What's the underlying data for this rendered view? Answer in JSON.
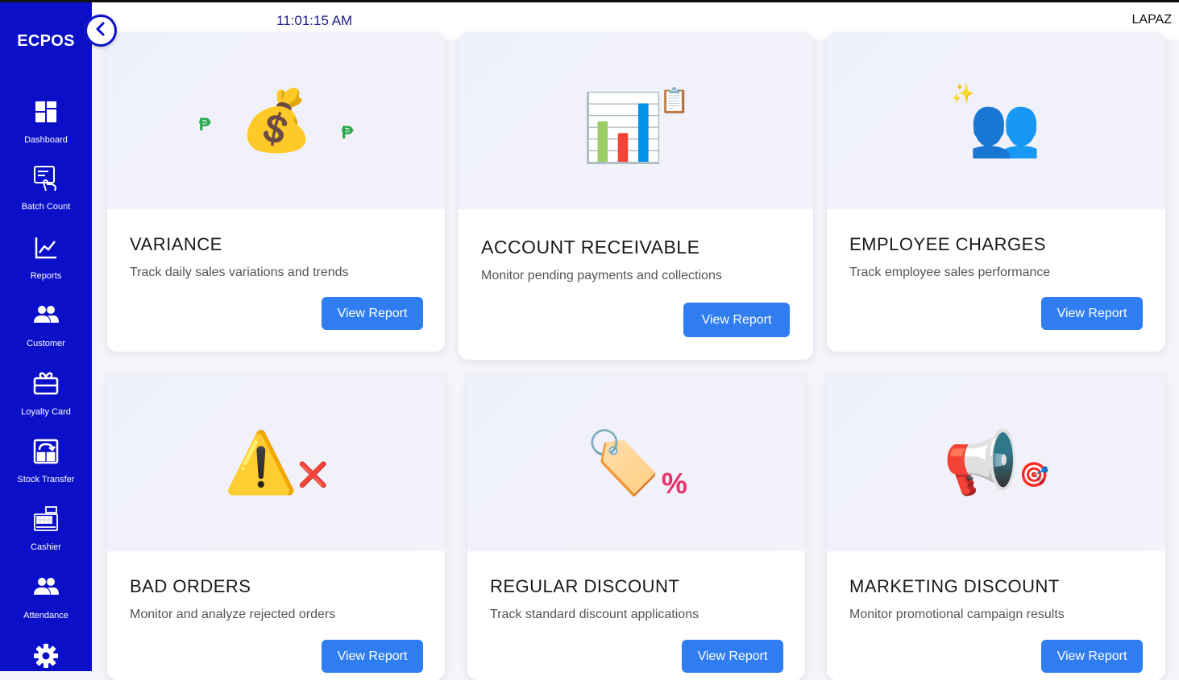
{
  "app": {
    "brand": "ECPOS"
  },
  "header": {
    "time": "11:01:15 AM",
    "branch": "LAPAZ"
  },
  "sidebar": {
    "items": [
      {
        "label": "Dashboard",
        "icon": "dashboard-icon"
      },
      {
        "label": "Batch Count",
        "icon": "batch-count-icon"
      },
      {
        "label": "Reports",
        "icon": "chart-line-icon"
      },
      {
        "label": "Customer",
        "icon": "people-icon"
      },
      {
        "label": "Loyalty Card",
        "icon": "gift-card-icon"
      },
      {
        "label": "Stock Transfer",
        "icon": "stock-transfer-icon"
      },
      {
        "label": "Cashier",
        "icon": "cash-register-icon"
      },
      {
        "label": "Attendance",
        "icon": "people-icon"
      },
      {
        "label": "",
        "icon": "gear-icon"
      }
    ]
  },
  "cards": [
    {
      "title": "VARIANCE",
      "description": "Track daily sales variations and trends",
      "button": "View Report",
      "icon": "money-bag-icon",
      "icon_glyph": "💰",
      "accent": "₱"
    },
    {
      "title": "ACCOUNT RECEIVABLE",
      "description": "Monitor pending payments and collections",
      "button": "View Report",
      "icon": "bar-chart-icon",
      "icon_glyph": "📊",
      "accent": "📋"
    },
    {
      "title": "EMPLOYEE CHARGES",
      "description": "Track employee sales performance",
      "button": "View Report",
      "icon": "people-icon",
      "icon_glyph": "👥",
      "accent": "✨"
    },
    {
      "title": "BAD ORDERS",
      "description": "Monitor and analyze rejected orders",
      "button": "View Report",
      "icon": "warning-icon",
      "icon_glyph": "⚠️",
      "accent": "❌"
    },
    {
      "title": "REGULAR DISCOUNT",
      "description": "Track standard discount applications",
      "button": "View Report",
      "icon": "price-tag-icon",
      "icon_glyph": "🏷️",
      "accent": "%"
    },
    {
      "title": "MARKETING DISCOUNT",
      "description": "Monitor promotional campaign results",
      "button": "View Report",
      "icon": "megaphone-icon",
      "icon_glyph": "📢",
      "accent": "🎯"
    }
  ],
  "colors": {
    "sidebar": "#0b10c8",
    "button": "#2f7df0",
    "clock": "#1d1d8c"
  }
}
